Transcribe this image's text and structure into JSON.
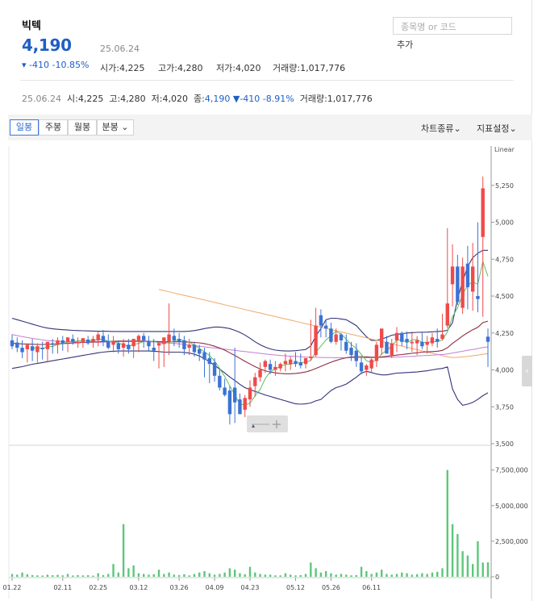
{
  "header": {
    "stock_name": "빅텍",
    "price": "4,190",
    "date": "25.06.24",
    "change": "▾ -410 -10.85%",
    "stats": [
      {
        "label": "시가",
        "value": "4,225"
      },
      {
        "label": "고가",
        "value": "4,280"
      },
      {
        "label": "저가",
        "value": "4,020"
      },
      {
        "label": "거래량",
        "value": "1,017,776"
      }
    ],
    "search_placeholder": "종목명 or 코드",
    "add_label": "추가"
  },
  "summary": {
    "date": "25.06.24",
    "open_label": "시",
    "open": "4,225",
    "high_label": "고",
    "high": "4,280",
    "low_label": "저",
    "low": "4,020",
    "close_label": "종",
    "close": "4,190",
    "change": "▼-410 -8.91%",
    "volume_label": "거래량",
    "volume": "1,017,776"
  },
  "toolbar": {
    "tabs": [
      "일봉",
      "주봉",
      "월봉",
      "분봉"
    ],
    "active_tab": "일봉",
    "chart_type_label": "차트종류",
    "indicator_label": "지표설정"
  },
  "colors": {
    "up": "#ee4a4a",
    "down": "#3a73d4",
    "volume": "#5cc77a",
    "bollinger": "#33337a",
    "ma5": "#5fbf5f",
    "ma20": "#8b2d3f",
    "ma60": "#c77dd6",
    "ma120": "#f0a868"
  },
  "chart_data": {
    "type": "candlestick",
    "price_scale": "Linear",
    "ylim": [
      3500,
      5500
    ],
    "y_ticks": [
      "5,250",
      "5,000",
      "4,750",
      "4,500",
      "4,250",
      "4,000",
      "3,750",
      "3,500"
    ],
    "volume_ylim": [
      0,
      8500000
    ],
    "volume_ticks": [
      "7,500,000",
      "5,000,000",
      "2,500,000",
      "0"
    ],
    "x_ticks": [
      "01.22",
      "02.11",
      "02.25",
      "03.12",
      "03.26",
      "04.09",
      "04.23",
      "05.12",
      "05.26",
      "06.11"
    ],
    "series": [
      {
        "name": "open",
        "values": [
          4200,
          4185,
          4150,
          4140,
          4160,
          4120,
          4150,
          4140,
          4180,
          4170,
          4200,
          4190,
          4210,
          4180,
          4185,
          4205,
          4190,
          4200,
          4230,
          4190,
          4170,
          4180,
          4150,
          4170,
          4160,
          4200,
          4230,
          4195,
          4150,
          4165,
          4175,
          4190,
          4230,
          4210,
          4200,
          4150,
          4170,
          4140,
          4120,
          4080,
          4050,
          3960,
          3880,
          3860,
          3880,
          3800,
          3730,
          3800,
          3890,
          3950,
          4020,
          4040,
          4000,
          4010,
          4040,
          4040,
          4060,
          4050,
          4040,
          4080,
          4100,
          4370,
          4300,
          4280,
          4190,
          4240,
          4190,
          4150,
          4130,
          4050,
          4000,
          4010,
          4060,
          4150,
          4190,
          4100,
          4200,
          4250,
          4210,
          4180,
          4180,
          4190,
          4170,
          4180,
          4210,
          4210,
          4300,
          4580,
          4700,
          4420,
          4720,
          4530,
          4500,
          4900,
          4225
        ]
      },
      {
        "name": "high",
        "values": [
          4240,
          4220,
          4200,
          4180,
          4210,
          4180,
          4190,
          4170,
          4210,
          4220,
          4230,
          4220,
          4240,
          4220,
          4210,
          4230,
          4230,
          4260,
          4270,
          4240,
          4230,
          4200,
          4210,
          4210,
          4210,
          4240,
          4250,
          4230,
          4210,
          4190,
          4200,
          4450,
          4280,
          4250,
          4230,
          4210,
          4190,
          4170,
          4150,
          4120,
          4080,
          4010,
          3940,
          3890,
          4150,
          3840,
          3830,
          3930,
          3980,
          4050,
          4070,
          4070,
          4060,
          4050,
          4110,
          4090,
          4120,
          4110,
          4080,
          4340,
          4420,
          4410,
          4340,
          4320,
          4280,
          4250,
          4240,
          4190,
          4180,
          4090,
          4040,
          4080,
          4190,
          4260,
          4230,
          4210,
          4290,
          4260,
          4260,
          4260,
          4230,
          4250,
          4230,
          4250,
          4280,
          4380,
          4960,
          4850,
          4780,
          4760,
          4840,
          4860,
          5000,
          5310,
          4280
        ]
      },
      {
        "name": "low",
        "values": [
          4140,
          4120,
          4080,
          4050,
          4060,
          4050,
          4070,
          4060,
          4110,
          4110,
          4130,
          4120,
          4170,
          4150,
          4150,
          4170,
          4150,
          4160,
          4160,
          4140,
          4120,
          4110,
          4090,
          4110,
          4080,
          4120,
          4150,
          4130,
          4060,
          4010,
          4020,
          4100,
          4160,
          4150,
          4100,
          4100,
          4090,
          4060,
          3950,
          3910,
          3920,
          3860,
          3820,
          3630,
          3640,
          3710,
          3680,
          3750,
          3820,
          3920,
          3980,
          3970,
          3960,
          3990,
          3990,
          4000,
          4020,
          4010,
          4010,
          4060,
          4090,
          4220,
          4220,
          4180,
          4170,
          4130,
          4110,
          4060,
          4020,
          3970,
          3960,
          3980,
          4020,
          4100,
          4110,
          4080,
          4120,
          4160,
          4140,
          4120,
          4100,
          4140,
          4110,
          4160,
          4150,
          4200,
          4280,
          4430,
          4440,
          4380,
          4410,
          4400,
          4390,
          4360,
          4020
        ]
      },
      {
        "name": "close",
        "values": [
          4160,
          4150,
          4120,
          4170,
          4130,
          4160,
          4140,
          4190,
          4170,
          4200,
          4180,
          4220,
          4190,
          4190,
          4215,
          4180,
          4210,
          4240,
          4190,
          4150,
          4190,
          4140,
          4180,
          4140,
          4210,
          4230,
          4200,
          4160,
          4130,
          4180,
          4220,
          4240,
          4200,
          4190,
          4140,
          4170,
          4120,
          4110,
          4070,
          4040,
          3960,
          3880,
          3830,
          3700,
          3780,
          3700,
          3810,
          3880,
          3950,
          4000,
          4060,
          4000,
          4020,
          4040,
          4060,
          4070,
          4040,
          4030,
          4080,
          4090,
          4300,
          4300,
          4280,
          4190,
          4240,
          4200,
          4130,
          4100,
          4060,
          3990,
          4030,
          4070,
          4170,
          4280,
          4110,
          4180,
          4250,
          4190,
          4190,
          4190,
          4200,
          4160,
          4190,
          4220,
          4190,
          4240,
          4450,
          4700,
          4460,
          4700,
          4560,
          4700,
          4480,
          5230,
          4190
        ]
      },
      {
        "name": "volume",
        "values": [
          200000,
          150000,
          300000,
          180000,
          120000,
          100000,
          90000,
          150000,
          110000,
          140000,
          100000,
          200000,
          90000,
          120000,
          100000,
          110000,
          80000,
          250000,
          120000,
          200000,
          900000,
          300000,
          3700000,
          600000,
          800000,
          250000,
          200000,
          150000,
          180000,
          500000,
          200000,
          300000,
          150000,
          120000,
          180000,
          100000,
          200000,
          300000,
          400000,
          250000,
          150000,
          200000,
          300000,
          600000,
          500000,
          250000,
          180000,
          700000,
          300000,
          200000,
          150000,
          150000,
          100000,
          100000,
          250000,
          150000,
          100000,
          120000,
          200000,
          1000000,
          600000,
          300000,
          400000,
          250000,
          150000,
          200000,
          150000,
          100000,
          120000,
          700000,
          400000,
          200000,
          300000,
          500000,
          200000,
          150000,
          200000,
          300000,
          250000,
          150000,
          180000,
          250000,
          200000,
          300000,
          350000,
          600000,
          7500000,
          3700000,
          3000000,
          1800000,
          1500000,
          900000,
          2500000,
          1000000,
          1017776
        ]
      },
      {
        "name": "MA5",
        "values": [
          null,
          null,
          null,
          null,
          4146,
          4150,
          4144,
          4158,
          4158,
          4172,
          4176,
          4192,
          4192,
          4196,
          4199,
          4199,
          4197,
          4207,
          4207,
          4194,
          4190,
          4182,
          4170,
          4160,
          4172,
          4180,
          4192,
          4192,
          4196,
          4180,
          4178,
          4186,
          4196,
          4206,
          4198,
          4188,
          4168,
          4146,
          4122,
          4098,
          4060,
          4010,
          3956,
          3892,
          3830,
          3768,
          3764,
          3774,
          3824,
          3868,
          3940,
          3988,
          4006,
          4024,
          4036,
          4038,
          4046,
          4050,
          4052,
          4064,
          4120,
          4162,
          4202,
          4232,
          4262,
          4242,
          4208,
          4172,
          4146,
          4104,
          4062,
          4050,
          4066,
          4108,
          4132,
          4162,
          4202,
          4202,
          4184,
          4202,
          4206,
          4186,
          4186,
          4192,
          4192,
          4202,
          4258,
          4360,
          4420,
          4510,
          4574,
          4596,
          4580,
          4734,
          4634
        ]
      },
      {
        "name": "MA20",
        "values": [
          4180,
          4178,
          4176,
          4175,
          4174,
          4172,
          4172,
          4173,
          4174,
          4176,
          4178,
          4180,
          4182,
          4184,
          4186,
          4188,
          4189,
          4190,
          4192,
          4193,
          4194,
          4195,
          4195,
          4195,
          4195,
          4195,
          4195,
          4194,
          4193,
          4192,
          4190,
          4190,
          4190,
          4190,
          4189,
          4188,
          4186,
          4183,
          4178,
          4170,
          4160,
          4148,
          4134,
          4116,
          4098,
          4078,
          4058,
          4040,
          4022,
          4006,
          3994,
          3986,
          3980,
          3976,
          3974,
          3974,
          3976,
          3980,
          3986,
          3996,
          4010,
          4024,
          4038,
          4052,
          4064,
          4074,
          4082,
          4088,
          4090,
          4090,
          4088,
          4086,
          4086,
          4088,
          4092,
          4096,
          4100,
          4104,
          4108,
          4112,
          4116,
          4120,
          4122,
          4124,
          4126,
          4132,
          4150,
          4180,
          4204,
          4230,
          4252,
          4272,
          4288,
          4320,
          4330
        ]
      },
      {
        "name": "MA60",
        "values": [
          4240,
          4232,
          4225,
          4219,
          4213,
          4208,
          4203,
          4199,
          4196,
          4194,
          4192,
          4190,
          4189,
          4188,
          4188,
          4187,
          4187,
          4187,
          4188,
          4189,
          4190,
          4191,
          4191,
          4192,
          4192,
          4192,
          4191,
          4190,
          4189,
          4187,
          4185,
          4182,
          4179,
          4176,
          4172,
          4168,
          4164,
          4160,
          4156,
          4152,
          4148,
          4144,
          4140,
          4136,
          4132,
          4128,
          4124,
          4120,
          4116,
          4112,
          4108,
          4104,
          4101,
          4098,
          4095,
          4093,
          4091,
          4089,
          4087,
          4086,
          4085,
          4084,
          4083,
          4083,
          4082,
          4082,
          4082,
          4082,
          4082,
          4082,
          4082,
          4083,
          4083,
          4084,
          4085,
          4086,
          4087,
          4088,
          4090,
          4092,
          4094,
          4096,
          4098,
          4100,
          4102,
          4104,
          4108,
          4114,
          4120,
          4126,
          4132,
          4138,
          4144,
          4152,
          4156
        ]
      },
      {
        "name": "MA120",
        "values": [
          null,
          null,
          null,
          null,
          null,
          null,
          null,
          null,
          null,
          null,
          null,
          null,
          null,
          null,
          null,
          null,
          null,
          null,
          null,
          null,
          null,
          null,
          null,
          null,
          null,
          null,
          null,
          null,
          null,
          4545,
          4537,
          4529,
          4521,
          4513,
          4505,
          4497,
          4489,
          4481,
          4473,
          4465,
          4457,
          4449,
          4441,
          4433,
          4425,
          4417,
          4409,
          4401,
          4393,
          4385,
          4377,
          4369,
          4361,
          4353,
          4345,
          4337,
          4329,
          4321,
          4313,
          4305,
          4297,
          4289,
          4281,
          4273,
          4265,
          4257,
          4249,
          4241,
          4233,
          4225,
          4217,
          4209,
          4201,
          4193,
          4185,
          4177,
          4169,
          4161,
          4153,
          4145,
          4137,
          4129,
          4121,
          4113,
          4105,
          4097,
          4089,
          4083,
          4085,
          4088,
          4092,
          4096,
          4100,
          4106,
          4110
        ]
      },
      {
        "name": "BB upper",
        "values": [
          4350,
          4340,
          4330,
          4320,
          4310,
          4300,
          4290,
          4283,
          4278,
          4275,
          4272,
          4270,
          4268,
          4266,
          4265,
          4264,
          4263,
          4262,
          4262,
          4261,
          4260,
          4260,
          4260,
          4260,
          4260,
          4260,
          4260,
          4260,
          4260,
          4260,
          4260,
          4260,
          4260,
          4260,
          4260,
          4262,
          4266,
          4272,
          4280,
          4285,
          4290,
          4290,
          4286,
          4280,
          4268,
          4254,
          4236,
          4214,
          4190,
          4170,
          4154,
          4142,
          4134,
          4130,
          4128,
          4128,
          4130,
          4134,
          4138,
          4162,
          4230,
          4280,
          4340,
          4350,
          4350,
          4345,
          4340,
          4320,
          4300,
          4262,
          4224,
          4200,
          4200,
          4210,
          4220,
          4235,
          4240,
          4245,
          4250,
          4252,
          4254,
          4255,
          4256,
          4258,
          4260,
          4262,
          4268,
          4320,
          4480,
          4600,
          4700,
          4760,
          4790,
          4810,
          4810
        ]
      },
      {
        "name": "BB lower",
        "values": [
          4010,
          4016,
          4022,
          4030,
          4038,
          4044,
          4050,
          4056,
          4062,
          4068,
          4074,
          4080,
          4086,
          4092,
          4098,
          4104,
          4110,
          4116,
          4120,
          4124,
          4126,
          4128,
          4128,
          4128,
          4128,
          4128,
          4128,
          4128,
          4126,
          4124,
          4120,
          4120,
          4120,
          4120,
          4118,
          4114,
          4106,
          4094,
          4076,
          4055,
          4030,
          4006,
          3980,
          3952,
          3928,
          3902,
          3880,
          3866,
          3854,
          3842,
          3830,
          3820,
          3810,
          3800,
          3790,
          3780,
          3770,
          3768,
          3770,
          3776,
          3790,
          3800,
          3830,
          3860,
          3880,
          3890,
          3904,
          3926,
          3950,
          3978,
          3990,
          3982,
          3972,
          3966,
          3966,
          3972,
          3978,
          3980,
          3982,
          3984,
          3986,
          3990,
          3994,
          4000,
          4006,
          4010,
          4020,
          3870,
          3800,
          3760,
          3768,
          3780,
          3800,
          3825,
          3845
        ]
      }
    ]
  }
}
